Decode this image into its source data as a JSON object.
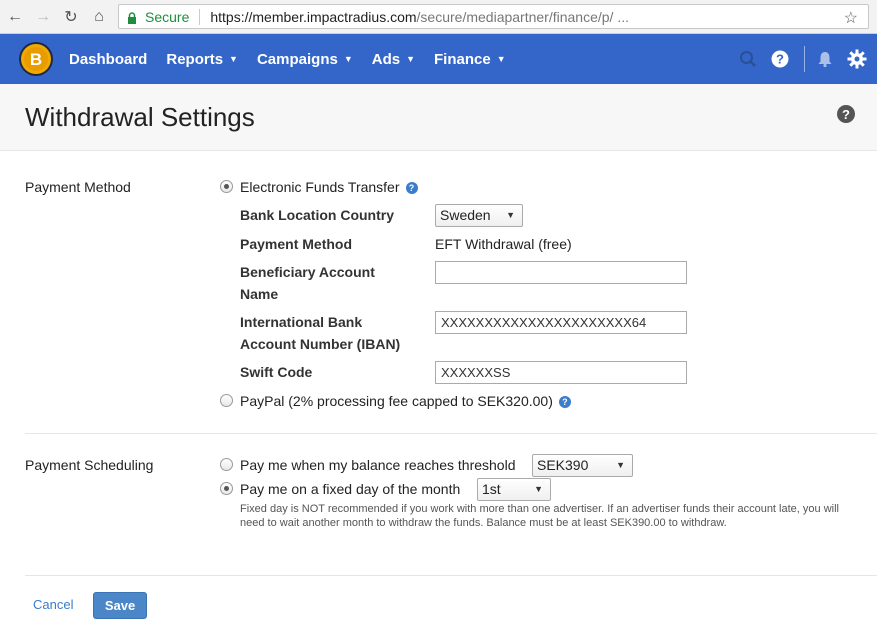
{
  "browser": {
    "secure_label": "Secure",
    "url_host": "https://member.impactradius.com",
    "url_path": "/secure/mediapartner/finance/p/ ..."
  },
  "nav": {
    "items": [
      {
        "label": "Dashboard",
        "has_caret": false
      },
      {
        "label": "Reports",
        "has_caret": true
      },
      {
        "label": "Campaigns",
        "has_caret": true
      },
      {
        "label": "Ads",
        "has_caret": true
      },
      {
        "label": "Finance",
        "has_caret": true
      }
    ],
    "color": "#3366c8"
  },
  "page": {
    "title": "Withdrawal Settings"
  },
  "payment_method": {
    "section_label": "Payment Method",
    "eft_label": "Electronic Funds Transfer",
    "bank_country_label": "Bank Location Country",
    "bank_country_value": "Sweden",
    "method_label": "Payment Method",
    "method_value": "EFT Withdrawal (free)",
    "beneficiary_label_1": "Beneficiary Account",
    "beneficiary_label_2": "Name",
    "beneficiary_value": "",
    "iban_label_1": "International Bank",
    "iban_label_2": "Account Number (IBAN)",
    "iban_value": "XXXXXXXXXXXXXXXXXXXXXX64",
    "swift_label": "Swift Code",
    "swift_value": "XXXXXXSS",
    "paypal_label": "PayPal (2% processing fee capped to SEK320.00)"
  },
  "scheduling": {
    "section_label": "Payment Scheduling",
    "threshold_label": "Pay me when my balance reaches threshold",
    "threshold_value": "SEK390",
    "fixed_label": "Pay me on a fixed day of the month",
    "fixed_value": "1st",
    "note": "Fixed day is NOT recommended if you work with more than one advertiser. If an advertiser funds their account late, you will need to wait another month to withdraw the funds. Balance must be at least SEK390.00 to withdraw."
  },
  "actions": {
    "cancel_label": "Cancel",
    "save_label": "Save"
  }
}
